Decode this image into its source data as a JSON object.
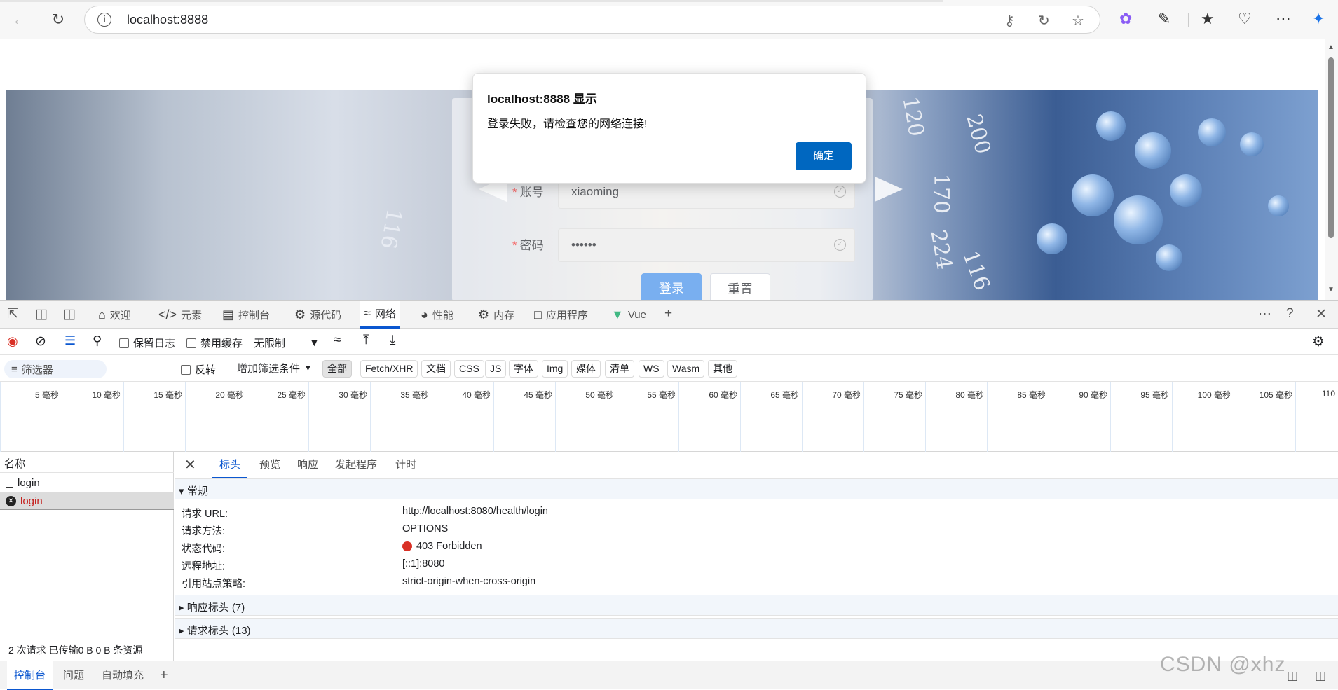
{
  "browser": {
    "url": "localhost:8888",
    "back_icon": "arrow-left",
    "reload_icon": "reload"
  },
  "login_page": {
    "account_label": "账号",
    "account_value": "xiaoming",
    "password_label": "密码",
    "password_value": "••••••",
    "required_mark": "*",
    "login_button": "登录",
    "reset_button": "重置"
  },
  "alert": {
    "title": "localhost:8888 显示",
    "message": "登录失败，请检查您的网络连接!",
    "ok_button": "确定"
  },
  "devtools": {
    "tabs": [
      {
        "label": "欢迎"
      },
      {
        "label": "元素"
      },
      {
        "label": "控制台"
      },
      {
        "label": "源代码"
      },
      {
        "label": "网络"
      },
      {
        "label": "性能"
      },
      {
        "label": "内存"
      },
      {
        "label": "应用程序"
      },
      {
        "label": "Vue"
      }
    ],
    "toolbar": {
      "preserve_log": "保留日志",
      "disable_cache": "禁用缓存",
      "throttle": "无限制"
    },
    "filter": {
      "placeholder": "筛选器",
      "invert": "反转",
      "more_filters": "增加筛选条件",
      "types": [
        "全部",
        "Fetch/XHR",
        "文档",
        "CSS",
        "JS",
        "字体",
        "Img",
        "媒体",
        "清单",
        "WS",
        "Wasm",
        "其他"
      ]
    },
    "timeline_ticks": [
      "5 毫秒",
      "10 毫秒",
      "15 毫秒",
      "20 毫秒",
      "25 毫秒",
      "30 毫秒",
      "35 毫秒",
      "40 毫秒",
      "45 毫秒",
      "50 毫秒",
      "55 毫秒",
      "60 毫秒",
      "65 毫秒",
      "70 毫秒",
      "75 毫秒",
      "80 毫秒",
      "85 毫秒",
      "90 毫秒",
      "95 毫秒",
      "100 毫秒",
      "105 毫秒",
      "110"
    ],
    "requests": {
      "header": "名称",
      "items": [
        {
          "name": "login",
          "status": "ok"
        },
        {
          "name": "login",
          "status": "error"
        }
      ],
      "summary": "2 次请求   已传输0 B   0 B 条资源"
    },
    "detail": {
      "tabs": [
        "标头",
        "预览",
        "响应",
        "发起程序",
        "计时"
      ],
      "general_section": "常规",
      "general": [
        {
          "key": "请求 URL:",
          "value": "http://localhost:8080/health/login"
        },
        {
          "key": "请求方法:",
          "value": "OPTIONS"
        },
        {
          "key": "状态代码:",
          "value": "403 Forbidden"
        },
        {
          "key": "远程地址:",
          "value": "[::1]:8080"
        },
        {
          "key": "引用站点策略:",
          "value": "strict-origin-when-cross-origin"
        }
      ],
      "response_headers": "响应标头 (7)",
      "request_headers": "请求标头 (13)"
    },
    "drawer": {
      "tabs": [
        "控制台",
        "问题",
        "自动填充"
      ]
    }
  },
  "watermark": "CSDN @xhz",
  "colors": {
    "accent": "#0b57d0",
    "error": "#d93025",
    "alert_button": "#0067c0",
    "primary_button": "#79aff0"
  }
}
